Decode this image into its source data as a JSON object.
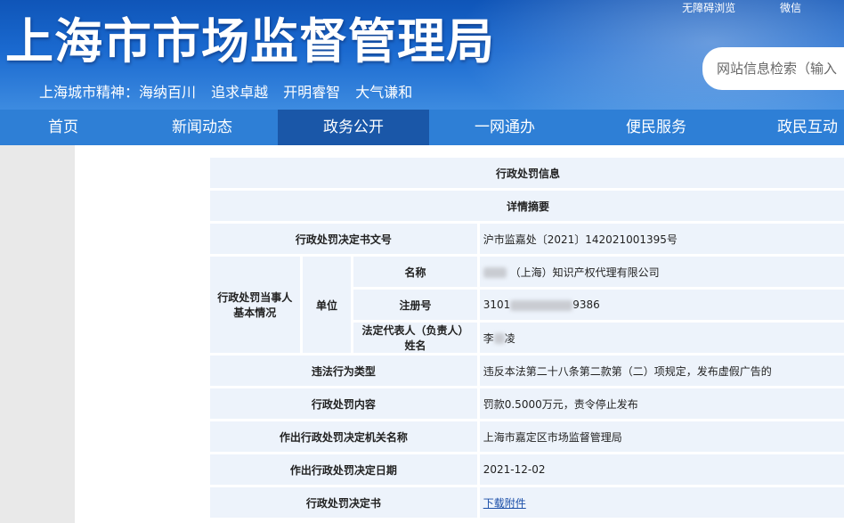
{
  "header": {
    "site_title": "上海市市场监督管理局",
    "slogan": "上海城市精神：海纳百川 追求卓越 开明睿智 大气谦和",
    "top_links": [
      "无障碍浏览",
      "微信"
    ],
    "search_placeholder": "网站信息检索（输入"
  },
  "nav": {
    "items": [
      "首页",
      "新闻动态",
      "政务公开",
      "一网通办",
      "便民服务",
      "政民互动"
    ],
    "active": "政务公开"
  },
  "record": {
    "section_title": "行政处罚信息",
    "sub_title": "详情摘要",
    "doc_no_label": "行政处罚决定书文号",
    "doc_no_value": "沪市监嘉处〔2021〕142021001395号",
    "party_label": "行政处罚当事人基本情况",
    "unit_label": "单位",
    "name_label": "名称",
    "name_value_visible": "（上海）知识产权代理有限公司",
    "reg_label": "注册号",
    "reg_prefix": "3101",
    "reg_suffix": "9386",
    "rep_label": "法定代表人（负责人）姓名",
    "rep_prefix": "李",
    "rep_suffix": "凌",
    "violation_label": "违法行为类型",
    "violation_value": "违反本法第二十八条第二款第（二）项规定，发布虚假广告的",
    "penalty_label": "行政处罚内容",
    "penalty_value": "罚款0.5000万元，责令停止发布",
    "authority_label": "作出行政处罚决定机关名称",
    "authority_value": "上海市嘉定区市场监督管理局",
    "date_label": "作出行政处罚决定日期",
    "date_value": "2021-12-02",
    "decision_label": "行政处罚决定书",
    "decision_link": "下载附件"
  },
  "colors": {
    "header_blue": "#1a69cf",
    "nav_blue": "#2e7fd6",
    "nav_active": "#1a57a8",
    "cell_bg": "#edf3fb"
  }
}
